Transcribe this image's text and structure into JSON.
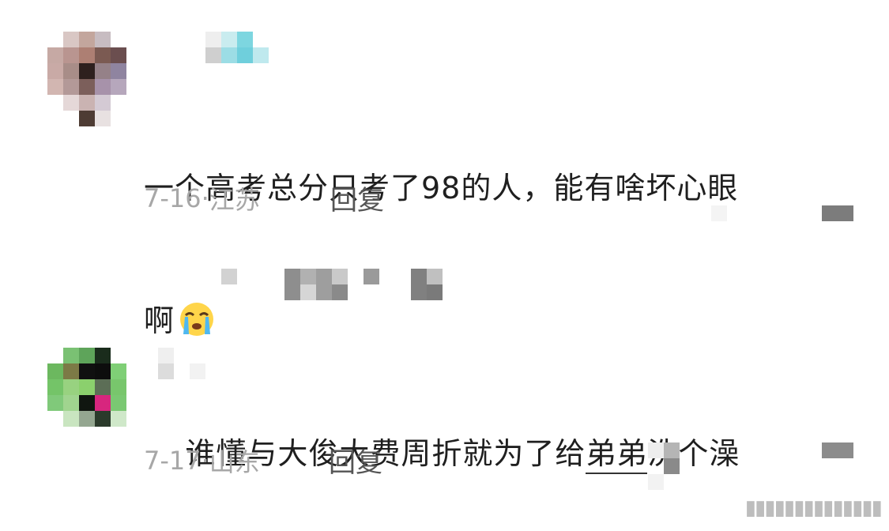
{
  "comments": [
    {
      "text_line1": "一个高考总分只考了98的人，能有啥坏心眼",
      "text_line2": "啊",
      "emoji": "loudly-crying-face-emoji",
      "date": "7-16·",
      "location": "江苏",
      "reply_label": "回复"
    },
    {
      "text_before_link": "谁懂与大俊大费周折就为了给",
      "link_text": "弟弟",
      "text_after_link": "洗个澡",
      "date": "7-17·",
      "location": "山东",
      "reply_label": "回复"
    }
  ],
  "watermark": "▮▮▮▮▮▮▮▮▮▮▮▮▮▮"
}
